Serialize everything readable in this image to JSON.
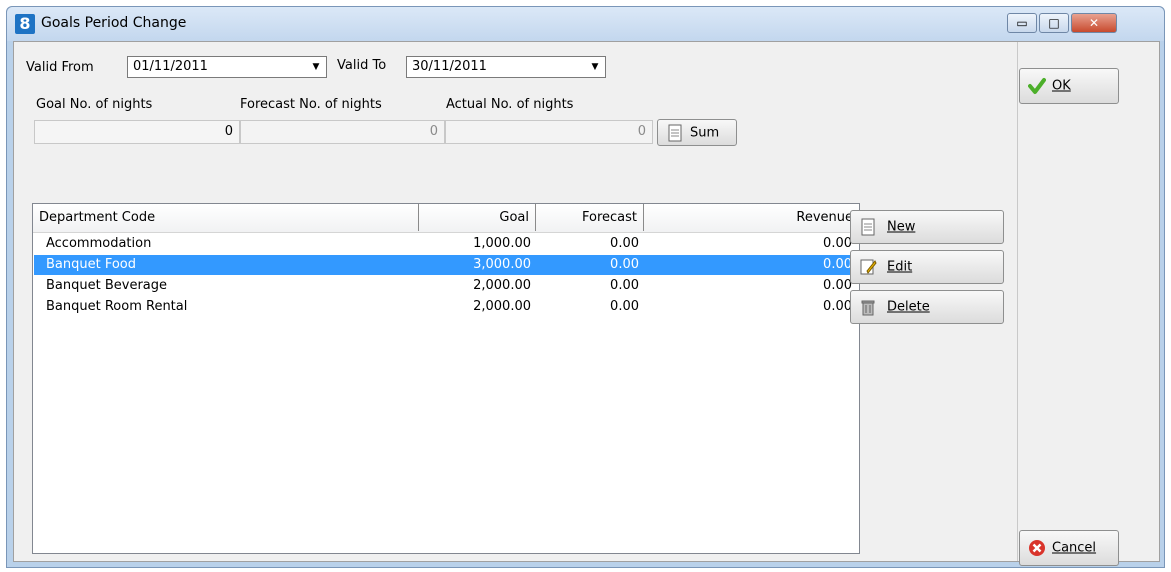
{
  "window": {
    "title": "Goals Period Change",
    "icon_label": "8",
    "min_glyph": "▭",
    "max_glyph": "□",
    "close_glyph": "✕"
  },
  "filters": {
    "valid_from_label": "Valid From",
    "valid_from_value": "01/11/2011",
    "valid_to_label": "Valid To",
    "valid_to_value": "30/11/2011"
  },
  "nights": {
    "goal_label": "Goal No. of nights",
    "goal_value": "0",
    "forecast_label": "Forecast No. of nights",
    "forecast_value": "0",
    "actual_label": "Actual No. of nights",
    "actual_value": "0",
    "sum_button": "Sum"
  },
  "table": {
    "columns": [
      "Department Code",
      "Goal",
      "Forecast",
      "Revenue"
    ],
    "rows": [
      {
        "dept": "Accommodation",
        "goal": "1,000.00",
        "forecast": "0.00",
        "revenue": "0.00",
        "selected": false
      },
      {
        "dept": "Banquet Food",
        "goal": "3,000.00",
        "forecast": "0.00",
        "revenue": "0.00",
        "selected": true
      },
      {
        "dept": "Banquet Beverage",
        "goal": "2,000.00",
        "forecast": "0.00",
        "revenue": "0.00",
        "selected": false
      },
      {
        "dept": "Banquet Room Rental",
        "goal": "2,000.00",
        "forecast": "0.00",
        "revenue": "0.00",
        "selected": false
      }
    ]
  },
  "actions": {
    "new": "New",
    "edit": "Edit",
    "delete": "Delete"
  },
  "dialog": {
    "ok": "OK",
    "cancel": "Cancel"
  },
  "colors": {
    "selection": "#3399ff",
    "ok_check": "#4caf2a",
    "cancel_red": "#d9342b"
  }
}
